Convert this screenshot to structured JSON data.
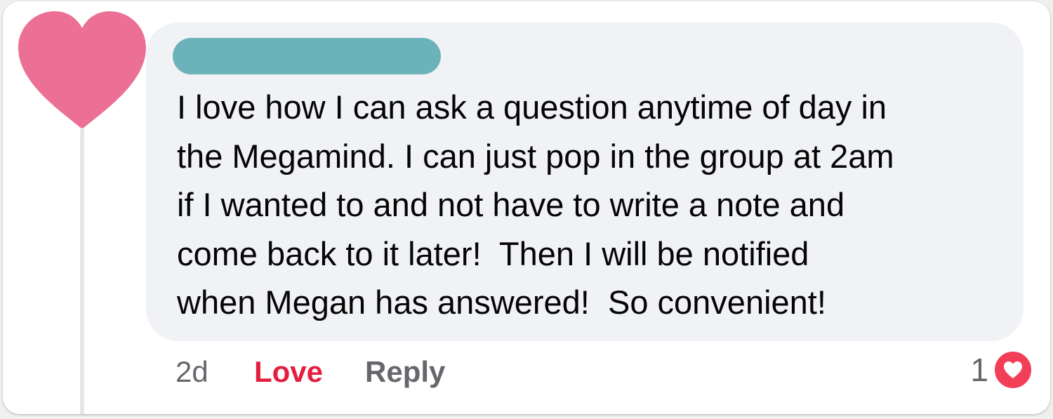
{
  "colors": {
    "avatar_heart": "#ec7096",
    "name_bar": "#6bb3b9",
    "bubble_bg": "#f0f2f5",
    "love_red": "#e41e3f",
    "meta_gray": "#65676b",
    "reaction_badge": "#f33e58"
  },
  "avatar": {
    "icon": "heart-icon"
  },
  "comment": {
    "author_redacted": true,
    "lines": [
      "I love how I can ask a question anytime of day in",
      "the Megamind. I can just pop in the group at 2am",
      "if I wanted to and not have to write a note and",
      "come back to it later!  Then I will be notified",
      "when Megan has answered!  So convenient!"
    ]
  },
  "actions": {
    "time": "2d",
    "love_label": "Love",
    "reply_label": "Reply"
  },
  "reactions": {
    "count": "1",
    "icon": "heart-reaction-icon"
  }
}
